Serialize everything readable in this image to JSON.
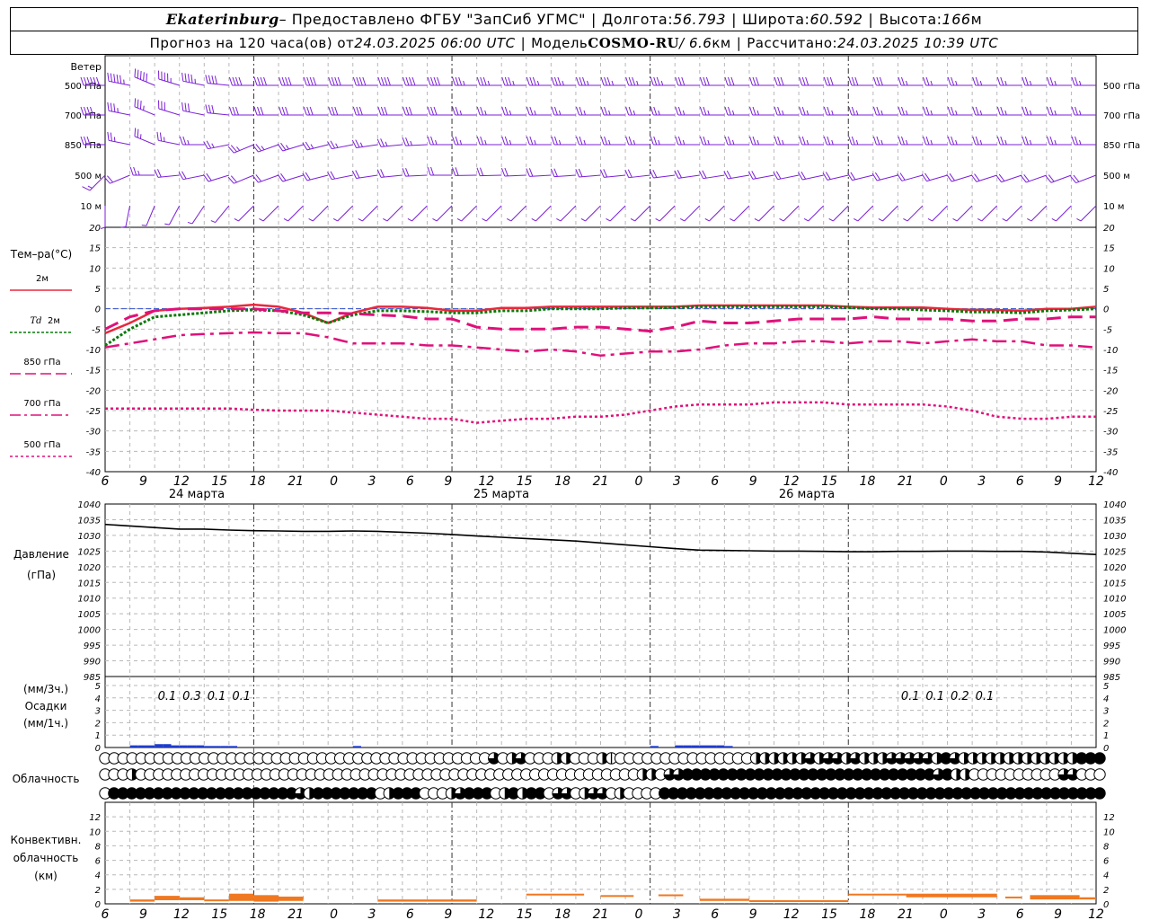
{
  "header": {
    "station": "Ekaterinburg",
    "provider": " – Предоставлено ФГБУ \"ЗапСиб УГМС\"",
    "lon_label": "Долгота: ",
    "lon_value": "56.793",
    "lat_label": "Широта: ",
    "lat_value": "60.592",
    "alt_label": "Высота: ",
    "alt_value": "166",
    "alt_unit": "м",
    "forecast_label": "Прогноз на 120 часа(ов) от ",
    "forecast_start": "24.03.2025 06:00 UTC",
    "model_label": "Модель ",
    "model_name": "COSMO-RU",
    "model_res": " / 6.6",
    "model_res_unit": "км",
    "calc_label": "Рассчитано: ",
    "calc_time": "24.03.2025 10:39 UTC"
  },
  "x_axis": {
    "hour_ticks": [
      "6",
      "9",
      "12",
      "15",
      "18",
      "21",
      "0",
      "3",
      "6",
      "9",
      "12",
      "15",
      "18",
      "21",
      "0",
      "3",
      "6",
      "9",
      "12",
      "15",
      "18",
      "21",
      "0",
      "3",
      "6",
      "9",
      "12"
    ],
    "dates": [
      "24 марта",
      "25 марта",
      "26 марта"
    ]
  },
  "colors": {
    "wind": "#7b1fd8",
    "t2m": "#e8283c",
    "td": "#0a7a0a",
    "t850": "#e0107a",
    "t700": "#e0107a",
    "t500": "#e0107a",
    "precip": "#1e3ccc",
    "conv": "#f07820"
  },
  "chart_data": [
    {
      "type": "wind-barbs",
      "title": "Ветер",
      "levels": [
        "500 гПа",
        "700 гПа",
        "850 гПа",
        "500 м",
        "10 м"
      ],
      "barb_samples": {
        "500 гПа": [
          [
            "24.03 06:00",
            "W",
            60
          ],
          [
            "24.03 12:00",
            "WNW",
            50
          ],
          [
            "25.03 00:00",
            "W",
            40
          ],
          [
            "26.03 00:00",
            "W",
            40
          ],
          [
            "27.03 12:00",
            "W",
            25
          ]
        ],
        "700 гПа": [
          [
            "24.03 06:00",
            "W",
            40
          ],
          [
            "24.03 12:00",
            "WNW",
            35
          ],
          [
            "25.03 00:00",
            "W",
            30
          ],
          [
            "26.03 00:00",
            "W",
            30
          ],
          [
            "27.03 12:00",
            "W",
            25
          ]
        ],
        "850 гПа": [
          [
            "24.03 06:00",
            "W",
            30
          ],
          [
            "24.03 12:00",
            "WNW",
            25
          ],
          [
            "25.03 00:00",
            "WSW",
            25
          ],
          [
            "26.03 00:00",
            "W",
            25
          ],
          [
            "27.03 12:00",
            "W",
            25
          ]
        ],
        "500 м": [
          [
            "24.03 06:00",
            "SW",
            15
          ],
          [
            "24.03 12:00",
            "W",
            25
          ],
          [
            "25.03 00:00",
            "WSW",
            20
          ],
          [
            "26.03 00:00",
            "W",
            20
          ],
          [
            "27.03 12:00",
            "WSW",
            25
          ]
        ],
        "10 м": [
          [
            "24.03 06:00",
            "S",
            5
          ],
          [
            "24.03 12:00",
            "SSW",
            5
          ],
          [
            "25.03 00:00",
            "SW",
            5
          ],
          [
            "26.03 00:00",
            "SW",
            5
          ],
          [
            "27.03 12:00",
            "SW",
            10
          ]
        ]
      }
    },
    {
      "type": "line",
      "title": "Тем-ра(°C)",
      "ylim": [
        -40,
        20
      ],
      "yticks": [
        20,
        15,
        10,
        5,
        0,
        -5,
        -10,
        -15,
        -20,
        -25,
        -30,
        -35,
        -40
      ],
      "legend_labels": [
        "2м",
        "Td",
        "2м",
        "850 гПа",
        "700 гПа",
        "500 гПа"
      ],
      "x_hours_from_start": [
        0,
        3,
        6,
        9,
        12,
        15,
        18,
        21,
        24,
        27,
        30,
        33,
        36,
        39,
        42,
        45,
        48,
        51,
        54,
        57,
        60,
        63,
        66,
        69,
        72,
        75,
        78,
        81,
        84,
        87,
        90,
        93,
        96,
        99,
        102,
        105,
        108,
        111,
        114,
        117,
        120
      ],
      "series": [
        {
          "name": "2м",
          "values": [
            -6,
            -3.5,
            -0.5,
            0,
            0.2,
            0.5,
            1,
            0.5,
            -1,
            -3.5,
            -1,
            0.5,
            0.5,
            0.2,
            -0.5,
            -0.5,
            0.2,
            0.2,
            0.5,
            0.5,
            0.5,
            0.5,
            0.5,
            0.5,
            0.8,
            0.8,
            0.8,
            0.8,
            0.8,
            0.8,
            0.5,
            0.3,
            0.3,
            0.3,
            0,
            -0.3,
            -0.3,
            -0.5,
            0,
            0,
            0.5
          ]
        },
        {
          "name": "Td 2м",
          "values": [
            -9,
            -5,
            -2,
            -1.5,
            -1,
            -0.5,
            -0.3,
            -0.5,
            -1.5,
            -3.5,
            -1.5,
            -0.5,
            -0.5,
            -0.7,
            -1,
            -1,
            -0.5,
            -0.5,
            0,
            0,
            0,
            0.2,
            0.2,
            0.3,
            0.5,
            0.5,
            0.5,
            0.5,
            0.5,
            0.5,
            0.3,
            0,
            0,
            -0.3,
            -0.5,
            -0.8,
            -0.8,
            -1,
            -0.5,
            -0.3,
            0
          ]
        },
        {
          "name": "850 гПа",
          "values": [
            -5,
            -2,
            -0.5,
            0,
            0,
            0,
            0,
            -0.5,
            -1,
            -1,
            -1.2,
            -1.5,
            -1.8,
            -2.5,
            -2.5,
            -4.5,
            -5,
            -5,
            -5,
            -4.5,
            -4.5,
            -5,
            -5.5,
            -4.5,
            -3,
            -3.5,
            -3.5,
            -3,
            -2.5,
            -2.5,
            -2.5,
            -2,
            -2.5,
            -2.5,
            -2.5,
            -3,
            -3,
            -2.5,
            -2.5,
            -2,
            -2
          ]
        },
        {
          "name": "700 гПа",
          "values": [
            -9.5,
            -8.5,
            -7.5,
            -6.5,
            -6.2,
            -6,
            -5.8,
            -6,
            -6,
            -7,
            -8.5,
            -8.5,
            -8.5,
            -9,
            -9,
            -9.5,
            -10,
            -10.5,
            -10,
            -10.5,
            -11.5,
            -11,
            -10.5,
            -10.5,
            -10,
            -9,
            -8.5,
            -8.5,
            -8,
            -8,
            -8.5,
            -8,
            -8,
            -8.5,
            -8,
            -7.5,
            -8,
            -8,
            -9,
            -9,
            -9.5
          ]
        },
        {
          "name": "500 гПа",
          "values": [
            -24.5,
            -24.5,
            -24.5,
            -24.5,
            -24.5,
            -24.5,
            -24.8,
            -25,
            -25,
            -25,
            -25.5,
            -26,
            -26.5,
            -27,
            -27,
            -28,
            -27.5,
            -27,
            -27,
            -26.5,
            -26.5,
            -26,
            -25,
            -24,
            -23.5,
            -23.5,
            -23.5,
            -23,
            -23,
            -23,
            -23.5,
            -23.5,
            -23.5,
            -23.5,
            -24,
            -25,
            -26.5,
            -27,
            -27,
            -26.5,
            -26.5
          ]
        }
      ]
    },
    {
      "type": "line",
      "title": "Давление",
      "ylabel": "(гПа)",
      "ylim": [
        985,
        1040
      ],
      "yticks": [
        1040,
        1035,
        1030,
        1025,
        1020,
        1015,
        1010,
        1005,
        1000,
        995,
        990,
        985
      ],
      "series": [
        {
          "name": "Давление",
          "values": [
            1033.5,
            1033,
            1032.5,
            1032,
            1032,
            1031.7,
            1031.5,
            1031.4,
            1031.3,
            1031.3,
            1031.4,
            1031.3,
            1031,
            1030.7,
            1030.3,
            1029.8,
            1029.4,
            1029,
            1028.6,
            1028.2,
            1027.6,
            1027,
            1026.4,
            1025.8,
            1025.3,
            1025.2,
            1025.1,
            1025,
            1025,
            1024.9,
            1024.8,
            1024.8,
            1024.9,
            1024.9,
            1025,
            1025,
            1024.9,
            1024.9,
            1024.7,
            1024.3,
            1023.9
          ]
        }
      ]
    },
    {
      "type": "bar",
      "title": "Осадки",
      "ylabel": "(мм/3ч.)",
      "ylabel2": "(мм/1ч.)",
      "ylim": [
        0,
        5
      ],
      "yticks": [
        5,
        4,
        3,
        2,
        1,
        0
      ],
      "labels": [
        [
          "0.1",
          1
        ],
        [
          "0.3",
          4
        ],
        [
          "0.1",
          7
        ],
        [
          "0.1",
          10
        ],
        [
          "0.1",
          91
        ],
        [
          "0.1",
          94
        ],
        [
          "0.2",
          97
        ],
        [
          "0.1",
          100
        ]
      ],
      "values_hourly_mm": [
        [
          "24.03 09:00",
          0.1
        ],
        [
          "24.03 10:00",
          0.1
        ],
        [
          "24.03 11:00",
          0.1
        ],
        [
          "24.03 12:00",
          0.2
        ],
        [
          "24.03 13:00",
          0.2
        ],
        [
          "24.03 14:00",
          0.1
        ],
        [
          "24.03 15:00",
          0.1
        ],
        [
          "24.03 16:00",
          0.1
        ],
        [
          "24.03 17:00",
          0.1
        ],
        [
          "24.03 18:00",
          0.05
        ],
        [
          "24.03 19:00",
          0.05
        ],
        [
          "24.03 20:00",
          0.05
        ],
        [
          "24.03 21:00",
          0.05
        ],
        [
          "25.03 12:00",
          0.05
        ],
        [
          "27.03 00:00",
          0.05
        ],
        [
          "27.03 03:00",
          0.1
        ],
        [
          "27.03 04:00",
          0.1
        ],
        [
          "27.03 05:00",
          0.1
        ],
        [
          "27.03 06:00",
          0.1
        ],
        [
          "27.03 07:00",
          0.1
        ],
        [
          "27.03 08:00",
          0.1
        ],
        [
          "27.03 09:00",
          0.05
        ]
      ]
    },
    {
      "type": "heatmap",
      "title": "Облачность",
      "rows": [
        {
          "name": "верхний ярус",
          "coverage": "0,0,0,0,0,0,0,0,0,0,0,0,0,0,0,0,0,0,0,0,0,0,0,0,0,0,0,0,0,0,0,0,0,0,0,0,0,0,0,0,0,0,0,3,0,2,3,0,0,0,2,2,0,0,0,2,1,0,0,0,0,0,0,0,0,0,0,0,0,0,0,0,2,2,2,2,2,2,3,2,3,3,2,3,2,2,2,3,3,3,3,3,2,4,3,2,2,2,2,2,2,2,2,2,2,2,2,2,4,4,4"
        },
        {
          "name": "средний ярус",
          "coverage": "0,0,0,2,0,0,0,0,0,0,0,0,0,0,0,0,0,0,0,0,0,0,0,0,0,0,0,0,0,0,0,0,0,0,0,0,0,0,0,0,0,0,0,0,0,0,0,0,0,0,0,0,0,0,0,0,0,0,0,0,2,2,0,3,3,4,4,4,4,4,4,4,4,4,4,4,4,4,4,4,4,4,4,4,4,4,4,4,4,4,4,4,4,3,4,2,2,0,0,0,0,0,0,0,0,0,0,3,3,0,0,0"
        },
        {
          "name": "нижний ярус",
          "coverage": "0,4,4,4,4,4,4,4,4,4,4,4,4,4,4,4,4,4,4,4,4,4,3,2,4,4,4,4,4,4,4,0,2,4,4,4,0,0,0,2,3,4,4,4,0,2,4,2,4,4,0,3,3,0,2,3,3,0,2,0,0,0,0,4,4,4,4,4,4,4,4,4,4,4,4,4,4,4,4,4,4,4,4,4,4,4,4,4,4,4,4,4,4,4,4,4,4,4,4,4,4,4,4,4,4,4,4,4,4,4,4,4,4"
        }
      ]
    },
    {
      "type": "bar",
      "title": "Конвективн. облачность",
      "ylabel": "(км)",
      "ylim": [
        0,
        13
      ],
      "yticks": [
        12,
        10,
        8,
        6,
        4,
        2,
        0
      ],
      "segments_km": [
        [
          3,
          6,
          0.3,
          0.6
        ],
        [
          6,
          9,
          0.5,
          1.1
        ],
        [
          9,
          12,
          0.5,
          0.9
        ],
        [
          12,
          15,
          0.4,
          0.6
        ],
        [
          15,
          18,
          0.4,
          1.4
        ],
        [
          18,
          21,
          0.3,
          1.2
        ],
        [
          21,
          24,
          0.4,
          1.0
        ],
        [
          33,
          45,
          0.3,
          0.6
        ],
        [
          51,
          58,
          1.4,
          1.4
        ],
        [
          60,
          64,
          1.2,
          1.2
        ],
        [
          67,
          70,
          1.3,
          1.3
        ],
        [
          72,
          78,
          0.4,
          0.7
        ],
        [
          78,
          90,
          0.3,
          0.5
        ],
        [
          90,
          97,
          1.2,
          1.4
        ],
        [
          97,
          108,
          0.9,
          1.4
        ],
        [
          109,
          111,
          0.8,
          1.0
        ],
        [
          112,
          118,
          0.6,
          1.2
        ],
        [
          118,
          120,
          0.6,
          0.9
        ]
      ]
    }
  ],
  "panels": {
    "wind_title": "Ветер",
    "wind_levels": [
      "500 гПа",
      "700 гПа",
      "850 гПа",
      "500 м",
      "10 м"
    ],
    "temp_title": "Тем–ра(°C)",
    "temp_legend": [
      "2м",
      "Td",
      "2м",
      "850 гПа",
      "700 гПа",
      "500 гПа"
    ],
    "press_title": "Давление",
    "press_unit": "(гПа)",
    "precip_unit3": "(мм/3ч.)",
    "precip_title": "Осадки",
    "precip_unit1": "(мм/1ч.)",
    "cloud_title": "Облачность",
    "conv_title1": "Конвективн.",
    "conv_title2": "облачность",
    "conv_unit": "(км)"
  }
}
